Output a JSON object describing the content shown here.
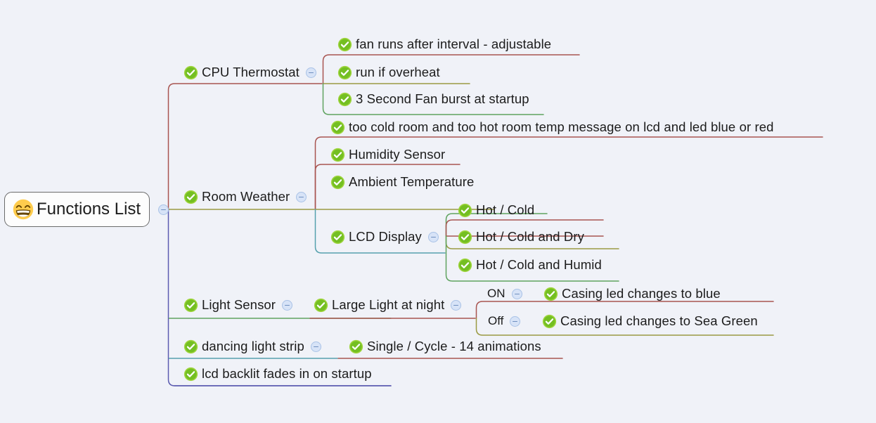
{
  "app": {
    "type": "mind-map",
    "background_color": "#f0f2f8",
    "text_color": "#1c1c1c"
  },
  "icons": {
    "root_emoji": "grinning-face-with-smiling-eyes",
    "node_icon": "green-check-circle-icon",
    "collapse_icon": "collapse-minus-icon"
  },
  "colors": {
    "check_green_light": "#9ed43c",
    "check_green_dark": "#5fae18",
    "collapse_fill": "#d7e3f7",
    "collapse_stroke": "#a9c2e6",
    "branch_red": "#a85450",
    "branch_olive": "#9a9a42",
    "branch_green": "#5fa35f",
    "branch_teal": "#55a0ad",
    "branch_blue": "#5c5cb0",
    "root_border": "#6b6b6b",
    "root_fill": "#fdfdfd"
  },
  "root": {
    "label": "Functions List",
    "collapsed": false
  },
  "nodes": {
    "cpu_thermostat": "CPU Thermostat",
    "fan_interval": "fan runs after interval - adjustable",
    "run_if_overheat": "run if overheat",
    "fan_burst": "3 Second Fan burst at startup",
    "room_weather": "Room Weather",
    "too_cold_hot": "too cold room and too hot room temp message on lcd and led blue or red",
    "humidity_sensor": "Humidity Sensor",
    "ambient_temperature": "Ambient Temperature",
    "lcd_display": "LCD Display",
    "hot_cold": "Hot / Cold",
    "hot_cold_dry": "Hot / Cold and Dry",
    "hot_cold_humid": "Hot / Cold and Humid",
    "light_sensor": "Light Sensor",
    "large_light_night": "Large Light at night",
    "on_label": "ON",
    "off_label": "Off",
    "casing_blue": "Casing led changes to blue",
    "casing_sea_green": "Casing led changes to Sea Green",
    "dancing_light_strip": "dancing light strip",
    "single_cycle": "Single / Cycle - 14 animations",
    "lcd_backlit": "lcd backlit fades in on startup"
  }
}
